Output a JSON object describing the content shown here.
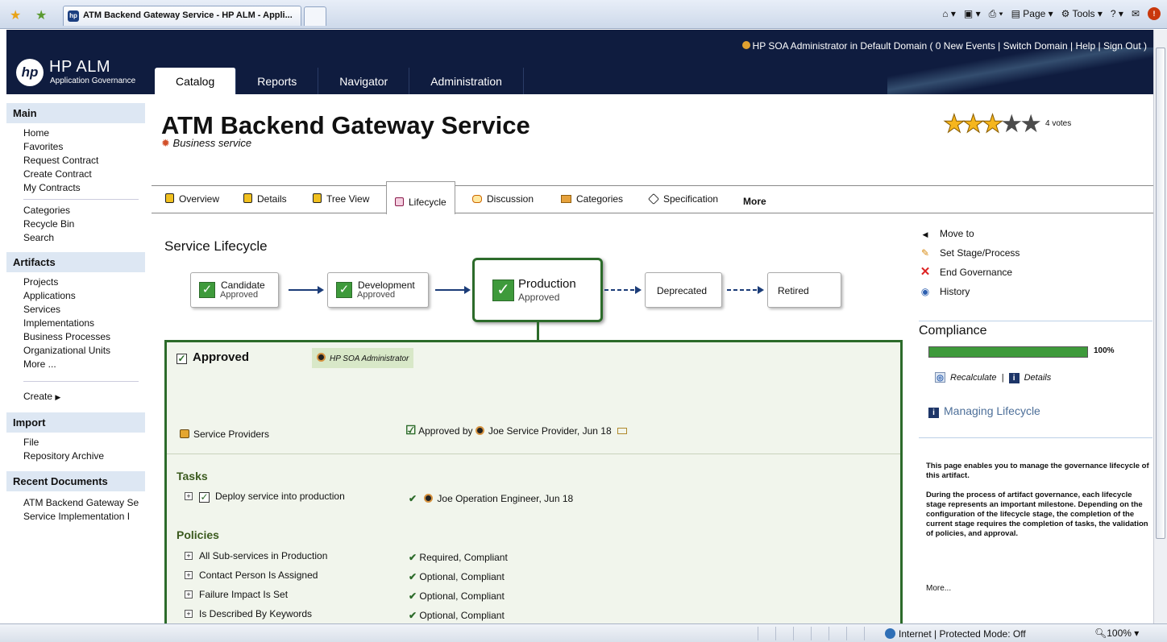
{
  "browser": {
    "tab_title": "ATM Backend Gateway Service - HP ALM - Appli...",
    "commands": {
      "page": "Page",
      "tools": "Tools"
    }
  },
  "header": {
    "brand": "HP ALM",
    "brand_sub": "Application Governance",
    "user": "HP SOA Administrator",
    "in": "in",
    "domain": "Default Domain",
    "events": "0 New Events",
    "switch_domain": "Switch Domain",
    "help": "Help",
    "sign_out": "Sign Out",
    "tabs": [
      "Catalog",
      "Reports",
      "Navigator",
      "Administration"
    ]
  },
  "sidebar": {
    "main_title": "Main",
    "main_items": [
      "Home",
      "Favorites",
      "Request Contract",
      "Create Contract",
      "My Contracts"
    ],
    "main_items2": [
      "Categories",
      "Recycle Bin",
      "Search"
    ],
    "artifacts_title": "Artifacts",
    "artifact_items": [
      "Projects",
      "Applications",
      "Services",
      "Implementations",
      "Business Processes",
      "Organizational Units",
      "More ..."
    ],
    "create": "Create",
    "import_title": "Import",
    "import_items": [
      "File",
      "Repository Archive"
    ],
    "recent_title": "Recent Documents",
    "recent_items": [
      "ATM Backend Gateway Se",
      "Service Implementation I"
    ]
  },
  "artifact": {
    "title": "ATM Backend Gateway Service",
    "type": "Business service",
    "rating": 3,
    "rating_max": 5,
    "votes": "4 votes"
  },
  "tabs": [
    "Overview",
    "Details",
    "Tree View",
    "Lifecycle",
    "Discussion",
    "Categories",
    "Specification",
    "More"
  ],
  "lifecycle": {
    "title": "Service Lifecycle",
    "stages": [
      {
        "name": "Candidate",
        "status": "Approved"
      },
      {
        "name": "Development",
        "status": "Approved"
      },
      {
        "name": "Production",
        "status": "Approved"
      },
      {
        "name": "Deprecated",
        "status": ""
      },
      {
        "name": "Retired",
        "status": ""
      }
    ],
    "approved": "Approved",
    "admin": "HP SOA Administrator",
    "providers": "Service Providers",
    "approved_by": "Approved by",
    "provider_name": "Joe Service Provider",
    "provider_date": ", Jun 18",
    "tasks_title": "Tasks",
    "task": "Deploy service into production",
    "task_user": "Joe Operation Engineer",
    "task_date": ", Jun 18",
    "policies_title": "Policies",
    "policies": [
      {
        "name": "All Sub-services in Production",
        "status": "Required, Compliant"
      },
      {
        "name": "Contact Person Is Assigned",
        "status": "Optional, Compliant"
      },
      {
        "name": "Failure Impact Is Set",
        "status": "Optional, Compliant"
      },
      {
        "name": "Is Described By Keywords",
        "status": "Optional, Compliant"
      }
    ]
  },
  "right": {
    "actions": [
      "Move to",
      "Set Stage/Process",
      "End Governance",
      "History"
    ],
    "compliance_title": "Compliance",
    "compliance_value": 100,
    "compliance_pct": "100%",
    "recalculate": "Recalculate",
    "details": "Details",
    "managing": "Managing Lifecycle",
    "desc1": "This page enables you to manage the governance lifecycle of this artifact.",
    "desc2": "During the process of artifact governance, each lifecycle stage represents an important milestone. Depending on the configuration of the lifecycle stage, the completion of the current stage requires the completion of tasks, the validation of policies, and approval.",
    "more": "More..."
  },
  "status": {
    "zone": "Internet | Protected Mode: Off",
    "zoom": "100%"
  },
  "colors": {
    "header": "#0f1c3f",
    "approved_green": "#2c6b2a",
    "panel_bg": "#f1f5ec"
  }
}
